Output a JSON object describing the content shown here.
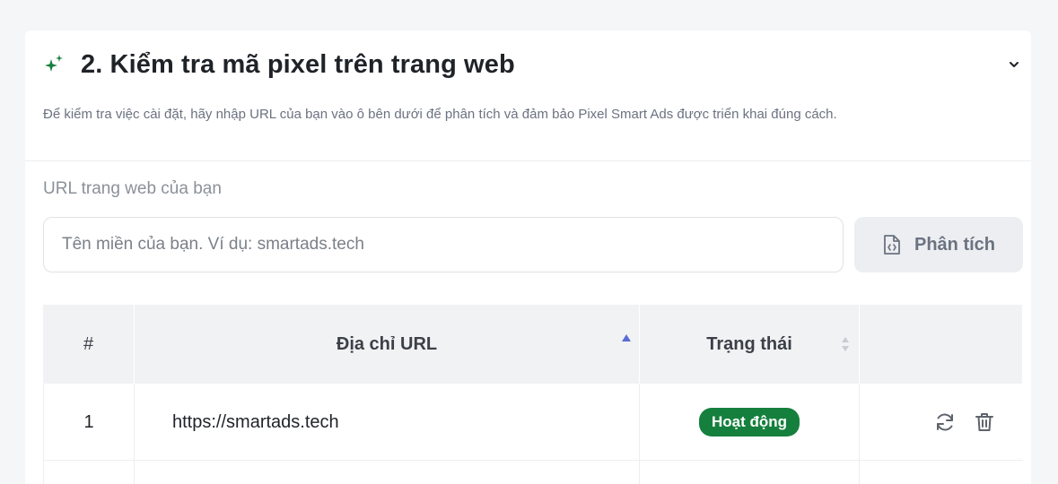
{
  "section": {
    "title": "2. Kiểm tra mã pixel trên trang web",
    "description": "Để kiểm tra việc cài đặt, hãy nhập URL của bạn vào ô bên dưới để phân tích và đảm bảo Pixel Smart Ads được triển khai đúng cách."
  },
  "form": {
    "label": "URL trang web của bạn",
    "input_value": "",
    "input_placeholder": "Tên miền của bạn. Ví dụ: smartads.tech",
    "analyze_label": "Phân tích"
  },
  "table": {
    "columns": [
      "#",
      "Địa chỉ URL",
      "Trạng thái",
      ""
    ],
    "rows": [
      {
        "index": "1",
        "url": "https://smartads.tech",
        "status": "Hoạt động"
      }
    ]
  },
  "colors": {
    "accent_green": "#15803d",
    "sort_active": "#5b6bd6"
  },
  "icons": {
    "title": "sparkle-icon",
    "collapse": "chevron-down-icon",
    "analyze": "file-code-icon",
    "sort_url": "sort-asc-icon",
    "sort_status": "sort-both-icon",
    "row_refresh": "refresh-icon",
    "row_delete": "trash-icon"
  }
}
